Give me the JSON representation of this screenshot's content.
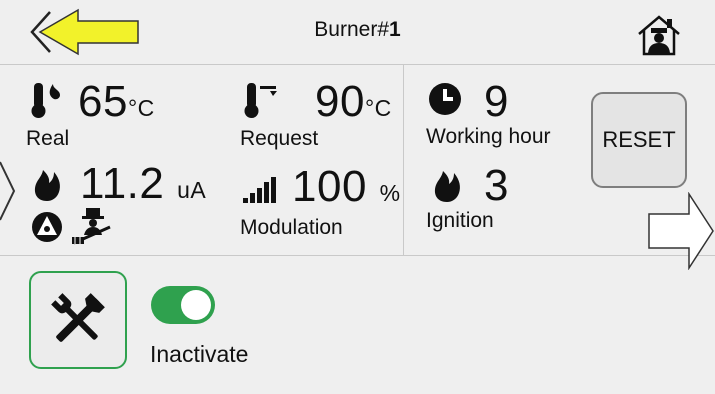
{
  "header": {
    "title_prefix": "Burner#",
    "title_number": "1"
  },
  "real": {
    "value": "65",
    "unit": "°C",
    "label": "Real"
  },
  "request": {
    "value": "90",
    "unit": "°C",
    "label": "Request"
  },
  "current": {
    "value": "11.2",
    "unit": "uA"
  },
  "modulation": {
    "value": "100",
    "unit": "%",
    "label": "Modulation"
  },
  "working_hour": {
    "value": "9",
    "label": "Working hour"
  },
  "ignition": {
    "value": "3",
    "label": "Ignition"
  },
  "reset_button": {
    "label": "RESET"
  },
  "inactivate_toggle": {
    "label": "Inactivate",
    "on": true
  },
  "colors": {
    "accent_green": "#2fa14e",
    "arrow_yellow": "#f2f22a",
    "background": "#efefef"
  },
  "icons": [
    "back-arrow-icon",
    "home-chef-icon",
    "thermometer-flame-icon",
    "thermometer-setpoint-icon",
    "flame-icon",
    "fan-icon",
    "chimney-sweep-icon",
    "signal-bars-icon",
    "clock-icon",
    "next-arrow-icon",
    "tools-icon"
  ]
}
